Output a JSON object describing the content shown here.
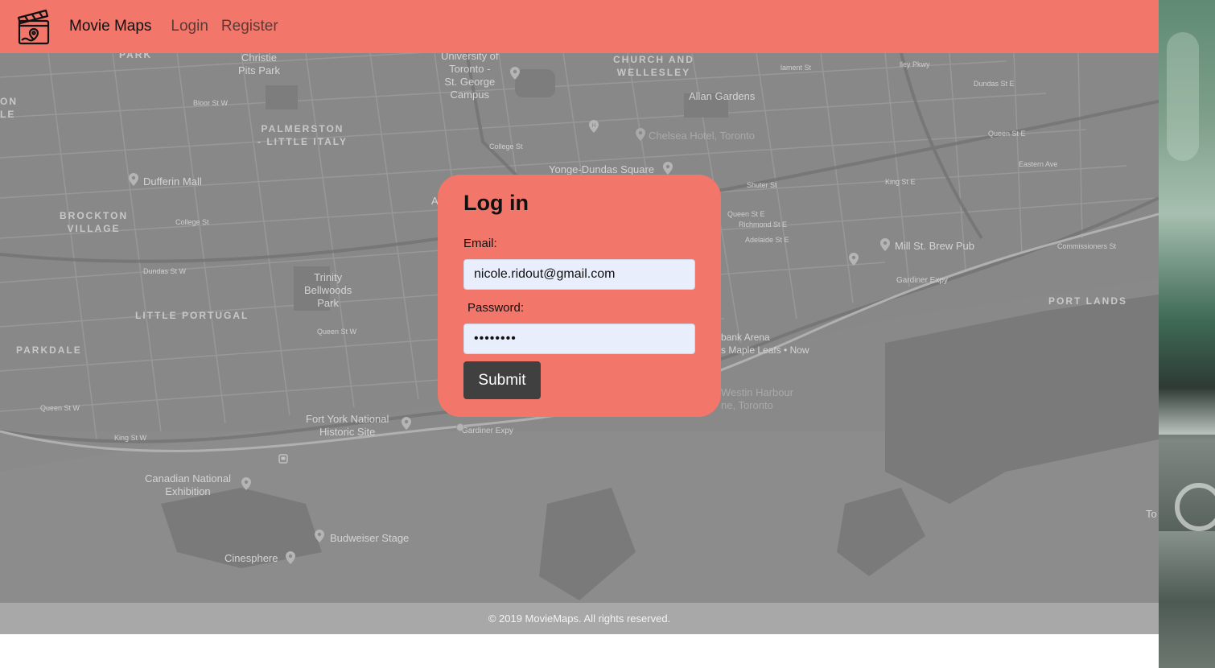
{
  "nav": {
    "brand": "Movie Maps",
    "links": [
      {
        "label": "Login"
      },
      {
        "label": "Register"
      }
    ],
    "logo_icon": "clapperboard-map-pin-icon"
  },
  "colors": {
    "brand_coral": "#f2776a",
    "button_dark": "#404040",
    "map_gray": "#8a8a8a",
    "footer_gray": "#a8a8a8"
  },
  "map": {
    "labels": {
      "christie_pits": "Christie\nPits Park",
      "uoft": "University of\nToronto -\nSt. George\nCampus",
      "church_wellesley": "CHURCH AND\nWELLESLEY",
      "allan_gardens": "Allan Gardens",
      "palmerston": "PALMERSTON\n- LITTLE ITALY",
      "chelsea_hotel": "Chelsea Hotel, Toronto",
      "dufferin_mall": "Dufferin Mall",
      "yonge_dundas": "Yonge-Dundas Square",
      "brockton": "BROCKTON\nVILLAGE",
      "trinity_bellwoods": "Trinity\nBellwoods\nPark",
      "little_portugal": "LITTLE PORTUGAL",
      "parkdale": "PARKDALE",
      "mill_st": "Mill St. Brew Pub",
      "port_lands": "PORT LANDS",
      "arena": "bank Arena\ns Maple Leafs • Now",
      "westin": "Westin Harbour\nne, Toronto",
      "fort_york": "Fort York National\nHistoric Site",
      "gardiner_1": "Gardiner Expy",
      "gardiner_2": "Gardiner Expy",
      "cne": "Canadian National\nExhibition",
      "budweiser": "Budweiser Stage",
      "cinesphere": "Cinesphere",
      "park": "PARK",
      "to": "To",
      "on_le": "ON\nLE",
      "bloor": "Bloor St W",
      "college": "College St",
      "college_w": "College St",
      "dundas_w": "Dundas St W",
      "queen_w": "Queen St W",
      "queen_w2": "Queen St W",
      "king_w": "King St W",
      "dundas_e": "Dundas St E",
      "queen_e": "Queen St E",
      "eastern": "Eastern Ave",
      "shuter": "Shuter St",
      "queen_e2": "Queen St E",
      "richmond": "Richmond St E",
      "adelaide": "Adelaide St E",
      "king_e": "King St E",
      "commissioners": "Commissioners St",
      "valley_pkwy": "lley Pkwy",
      "sherbourne": "lament St",
      "a_label": "A"
    }
  },
  "login": {
    "title": "Log in",
    "email_label": "Email:",
    "email_value": "nicole.ridout@gmail.com",
    "password_label": "Password:",
    "password_value": "••••••••",
    "submit_label": "Submit"
  },
  "footer": {
    "text": "© 2019 MovieMaps. All rights reserved."
  }
}
